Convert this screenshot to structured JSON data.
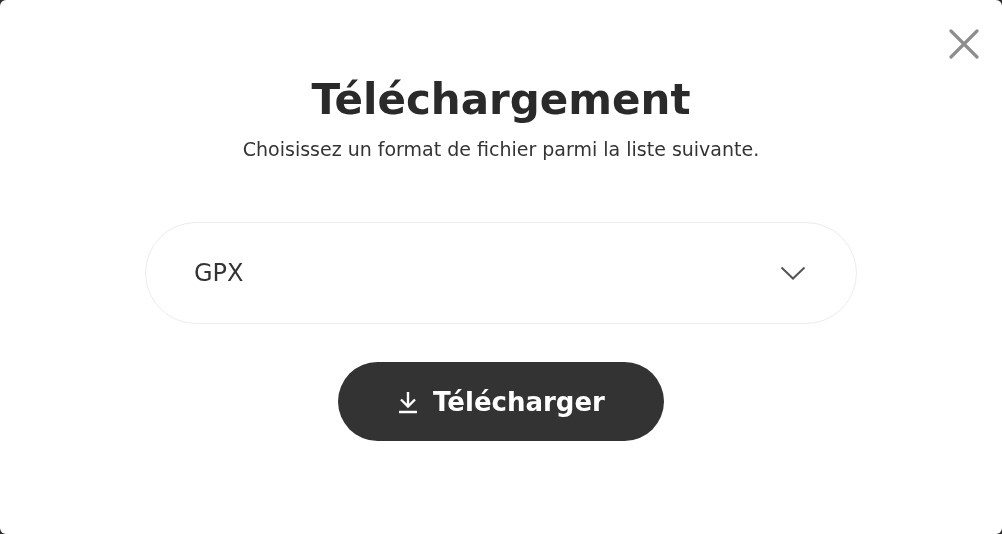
{
  "dialog": {
    "title": "Téléchargement",
    "subtitle": "Choisissez un format de fichier parmi la liste suivante."
  },
  "format_select": {
    "value": "GPX"
  },
  "download_button": {
    "label": "Télécharger"
  }
}
